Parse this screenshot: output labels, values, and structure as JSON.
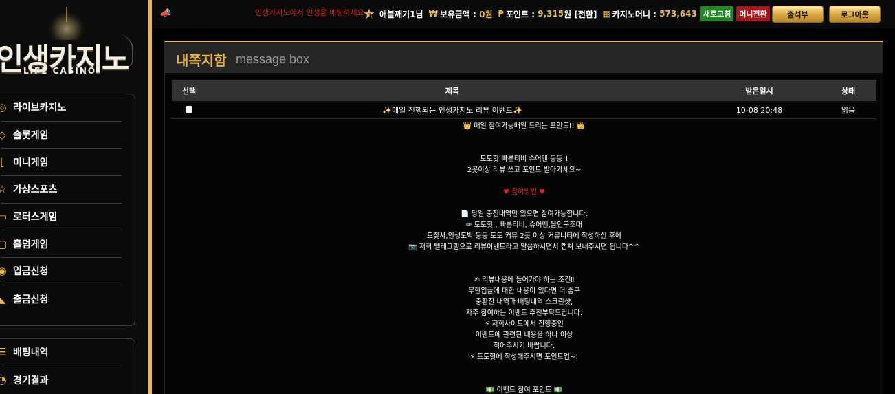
{
  "logo": {
    "title": "인생카지노",
    "subtitle": "LIFE CASINO"
  },
  "sidebar": {
    "menu1": [
      {
        "label": "라이브카지노",
        "icon": "casino-chip-icon"
      },
      {
        "label": "슬롯게임",
        "icon": "slot-icon"
      },
      {
        "label": "미니게임",
        "icon": "mini-game-icon"
      },
      {
        "label": "가상스포츠",
        "icon": "virtual-sports-icon"
      },
      {
        "label": "로터스게임",
        "icon": "lotus-icon"
      },
      {
        "label": "홀덤게임",
        "icon": "holdem-icon"
      },
      {
        "label": "입금신청",
        "icon": "deposit-icon"
      },
      {
        "label": "출금신청",
        "icon": "withdraw-icon"
      }
    ],
    "menu2": [
      {
        "label": "배팅내역",
        "icon": "list-icon"
      },
      {
        "label": "경기결과",
        "icon": "result-icon"
      }
    ]
  },
  "topbar": {
    "marquee": "인생카지노에서 인생을 배팅하세요",
    "level": "1",
    "username": "애블깨기1",
    "username_suffix": "님",
    "balance_label": "보유금액 :",
    "balance_value": "0원",
    "points_label": "포인트 :",
    "points_value": "9,315",
    "points_unit": "원",
    "points_convert": "[전환]",
    "casino_money_label": "카지노머니 :",
    "casino_money_value": "573,643",
    "refresh_label": "새로고침",
    "money_convert_label": "머니전환",
    "attendance_label": "출석부",
    "logout_label": "로그아웃"
  },
  "panel": {
    "title": "내쪽지함",
    "title_en": "message box"
  },
  "table": {
    "headers": {
      "select": "선택",
      "title": "제목",
      "date": "받은일시",
      "status": "상태"
    },
    "rows": [
      {
        "title": "매일 진행되는 인생카지노 리뷰 이벤트",
        "date": "10-08 20:48",
        "status": "읽음"
      }
    ]
  },
  "message": {
    "lines": [
      "👑 매일 참여가능매일 드리는 포인트!! 👑",
      "",
      "",
      "토토핫 빠른티비 슈어맨 등등!!",
      "2곳이상 리뷰 쓰고 포인트 받아가세요~",
      "",
      "♥ 참여방법 ♥",
      "",
      "📄 당일 충전내역만 있으면 참여가능합니다.",
      "✏ 토토핫 , 빠른티비, 슈어맨,올인구조대",
      "토찾사,인생도박 등등 토토 커뮤 2곳 이상 커뮤니티에 작성하신 후에",
      "📷 저희 텔레그램으로 리뷰이벤트라고 말씀하시면서 캡쳐 보내주시면 됩니다^^",
      "",
      "",
      "✍ 리뷰내용에 들어가야 하는 조건‼",
      "무한입플에 대한 내용이 있다면 더 좋구",
      "충환전 내역과 배팅내역 스크린샷,",
      "자주 참여하는 이벤트 추천부탁드립니다.",
      "⚡ 저희사이트에서 진행중인",
      "이벤트에 관련된 내용을 하나 이상",
      "적어주시기 바랍니다.",
      "⚡ 토토핫에 작성해주시면 포인트업~!",
      "",
      "",
      "💵 이벤트 참여 포인트 💵"
    ]
  }
}
